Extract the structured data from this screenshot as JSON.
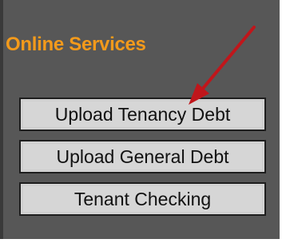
{
  "panel": {
    "title": "Online Services",
    "title_color": "#f39a1b",
    "background_color": "#575757"
  },
  "buttons": [
    {
      "label": "Upload Tenancy Debt"
    },
    {
      "label": "Upload General Debt"
    },
    {
      "label": "Tenant Checking"
    }
  ],
  "annotation": {
    "icon": "red-arrow-icon",
    "color": "#c0161b"
  }
}
